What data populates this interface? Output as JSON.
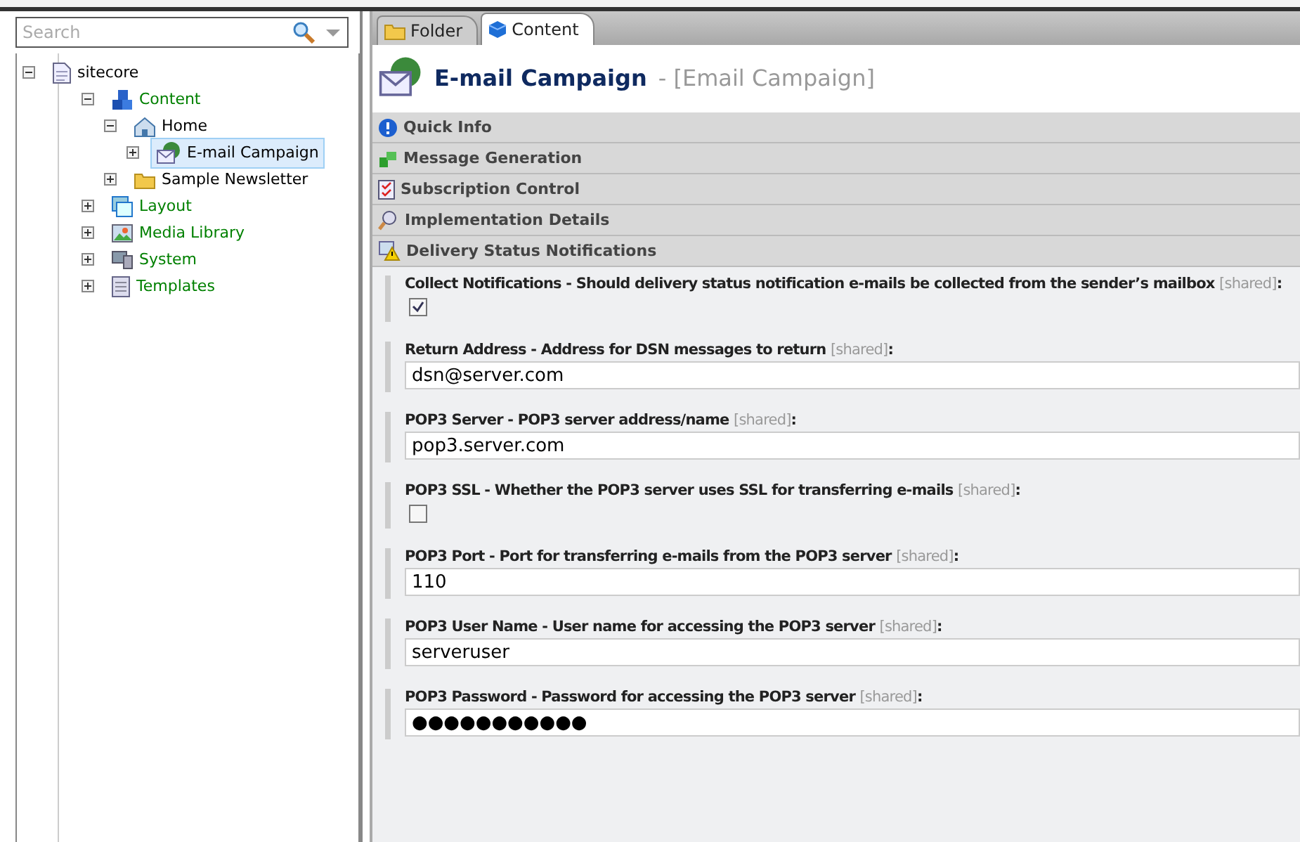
{
  "search": {
    "placeholder": "Search"
  },
  "tree": [
    {
      "label": "sitecore",
      "kind": "document",
      "color": "#000000",
      "expanded": true,
      "selected": false,
      "children": [
        {
          "label": "Content",
          "kind": "cubes",
          "color": "#008000",
          "expanded": true,
          "selected": false,
          "children": [
            {
              "label": "Home",
              "kind": "home",
              "color": "#000000",
              "expanded": true,
              "selected": false,
              "children": [
                {
                  "label": "E-mail Campaign",
                  "kind": "email",
                  "color": "#000000",
                  "expanded": false,
                  "selected": true
                }
              ]
            },
            {
              "label": "Sample Newsletter",
              "kind": "folder",
              "color": "#000000",
              "expanded": false,
              "selected": false
            }
          ]
        },
        {
          "label": "Layout",
          "kind": "layout",
          "color": "#008000",
          "expanded": false,
          "selected": false
        },
        {
          "label": "Media Library",
          "kind": "media",
          "color": "#008000",
          "expanded": false,
          "selected": false
        },
        {
          "label": "System",
          "kind": "system",
          "color": "#008000",
          "expanded": false,
          "selected": false
        },
        {
          "label": "Templates",
          "kind": "templates",
          "color": "#008000",
          "expanded": false,
          "selected": false
        }
      ]
    }
  ],
  "tabs": [
    {
      "label": "Folder",
      "kind": "folder",
      "selected": false
    },
    {
      "label": "Content",
      "kind": "cube",
      "selected": true
    }
  ],
  "header": {
    "title": "E-mail Campaign",
    "subtitle": "- [Email Campaign]"
  },
  "sections": [
    {
      "label": "Quick Info",
      "kind": "info"
    },
    {
      "label": "Message Generation",
      "kind": "generate"
    },
    {
      "label": "Subscription Control",
      "kind": "checklist"
    },
    {
      "label": "Implementation Details",
      "kind": "search"
    },
    {
      "label": "Delivery Status Notifications",
      "kind": "warning"
    }
  ],
  "fields": [
    {
      "kind": "checkbox",
      "label": "Collect Notifications - Should delivery status notification e-mails be collected from the sender’s mailbox",
      "shared": "[shared]",
      "colon": ":",
      "checked": true
    },
    {
      "kind": "text",
      "label": "Return Address - Address for DSN messages to return",
      "shared": "[shared]",
      "colon": ":",
      "value": "dsn@server.com"
    },
    {
      "kind": "text",
      "label": "POP3 Server - POP3 server address/name",
      "shared": "[shared]",
      "colon": ":",
      "value": "pop3.server.com"
    },
    {
      "kind": "checkbox",
      "label": "POP3 SSL - Whether the POP3 server uses SSL for transferring e-mails",
      "shared": "[shared]",
      "colon": ":",
      "checked": false
    },
    {
      "kind": "text",
      "label": "POP3 Port - Port for transferring e-mails from the POP3 server",
      "shared": "[shared]",
      "colon": ":",
      "value": "110"
    },
    {
      "kind": "text",
      "label": "POP3 User Name - User name for accessing the POP3 server",
      "shared": "[shared]",
      "colon": ":",
      "value": "serveruser"
    },
    {
      "kind": "text",
      "label": "POP3 Password - Password for accessing the POP3 server",
      "shared": "[shared]",
      "colon": ":",
      "value": "●●●●●●●●●●●"
    }
  ]
}
